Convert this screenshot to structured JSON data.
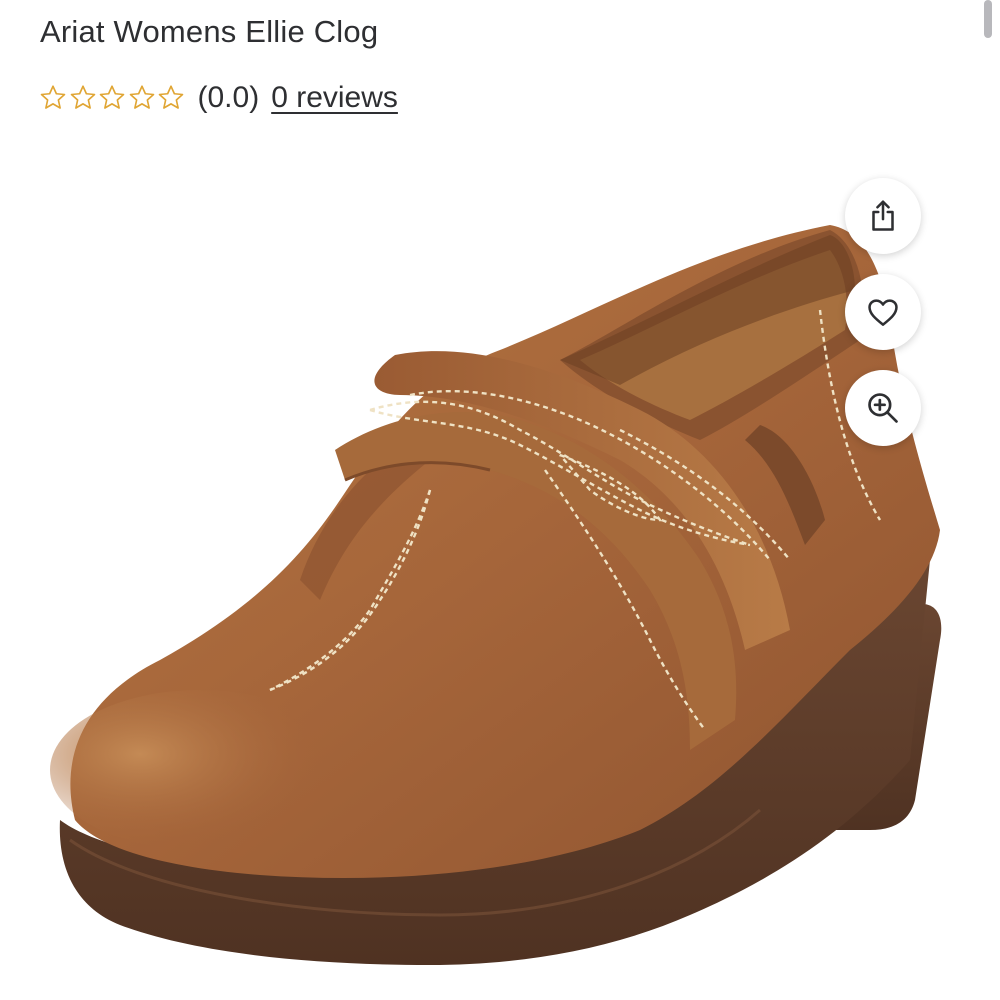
{
  "product": {
    "title": "Ariat Womens Ellie Clog",
    "rating": {
      "stars_filled": 0,
      "stars_total": 5,
      "score_text": "(0.0)",
      "reviews_link": "0 reviews",
      "star_color": "#e0a533"
    }
  },
  "actions": [
    {
      "name": "share",
      "icon": "share-icon"
    },
    {
      "name": "favorite",
      "icon": "heart-icon"
    },
    {
      "name": "zoom",
      "icon": "zoom-in-icon"
    }
  ],
  "colors": {
    "text": "#2e2f32",
    "leather": "#a8683a",
    "sole": "#5e3d2a",
    "stitch": "#efe2c4"
  }
}
